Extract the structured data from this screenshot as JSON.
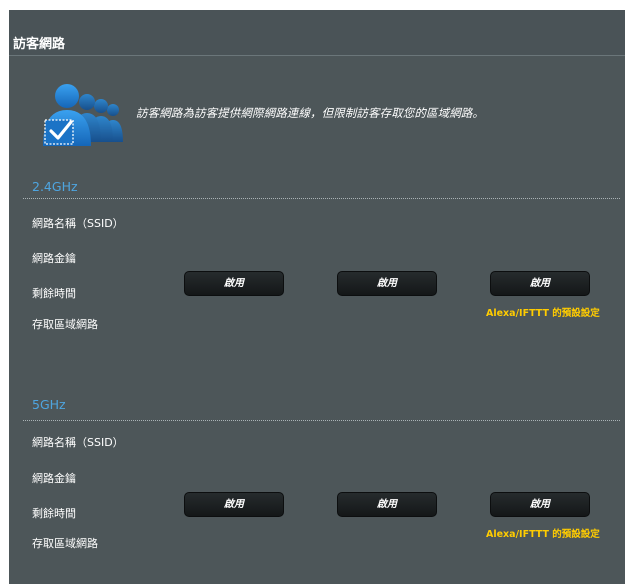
{
  "header": {
    "title": "訪客網路"
  },
  "intro": {
    "description": "訪客網路為訪客提供網際網路連線，但限制訪客存取您的區域網路。"
  },
  "bands": [
    {
      "label": "2.4GHz",
      "rows": {
        "ssid": "網路名稱（SSID）",
        "key": "網路金鑰",
        "time": "剩餘時間",
        "access": "存取區域網路"
      },
      "buttons": [
        "啟用",
        "啟用",
        "啟用"
      ],
      "alexa_note": "Alexa/IFTTT 的預設設定"
    },
    {
      "label": "5GHz",
      "rows": {
        "ssid": "網路名稱（SSID）",
        "key": "網路金鑰",
        "time": "剩餘時間",
        "access": "存取區域網路"
      },
      "buttons": [
        "啟用",
        "啟用",
        "啟用"
      ],
      "alexa_note": "Alexa/IFTTT 的預設設定"
    }
  ],
  "colors": {
    "panel": "#4d5659",
    "band_label": "#4ea5e0",
    "alexa_note": "#ffcc00",
    "icon_blue": "#1e88d8"
  }
}
